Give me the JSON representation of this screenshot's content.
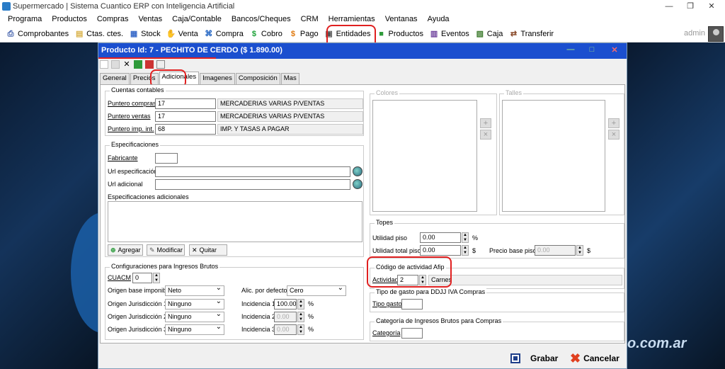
{
  "app": {
    "title": "Supermercado | Sistema Cuantico ERP con Inteligencia Artificial",
    "user": "admin",
    "brand_text": "o.com.ar"
  },
  "window_controls": {
    "minimize": "—",
    "maximize": "❐",
    "close": "✕"
  },
  "menu": [
    "Programa",
    "Productos",
    "Compras",
    "Ventas",
    "Caja/Contable",
    "Bancos/Cheques",
    "CRM",
    "Herramientas",
    "Ventanas",
    "Ayuda"
  ],
  "toolbar": [
    {
      "label": "Comprobantes",
      "icon": "printer-icon",
      "color": "#3a5aa8",
      "glyph": "⎙"
    },
    {
      "label": "Ctas. ctes.",
      "icon": "folder-icon",
      "color": "#d9b24a",
      "glyph": "▤"
    },
    {
      "label": "Stock",
      "icon": "stock-icon",
      "color": "#3a6bc9",
      "glyph": "▦"
    },
    {
      "label": "Venta",
      "icon": "hand-icon",
      "color": "#7a8aa0",
      "glyph": "✋"
    },
    {
      "label": "Compra",
      "icon": "cart-icon",
      "color": "#1a5fc0",
      "glyph": "⌘"
    },
    {
      "label": "Cobro",
      "icon": "dollar-in-icon",
      "color": "#1fa33a",
      "glyph": "$"
    },
    {
      "label": "Pago",
      "icon": "dollar-out-icon",
      "color": "#e07a10",
      "glyph": "$"
    },
    {
      "label": "Entidades",
      "icon": "entities-icon",
      "color": "#555",
      "glyph": "▣"
    },
    {
      "label": "Productos",
      "icon": "box-icon",
      "color": "#2f9a3a",
      "glyph": "■"
    },
    {
      "label": "Eventos",
      "icon": "events-icon",
      "color": "#6a3d9a",
      "glyph": "▥"
    },
    {
      "label": "Caja",
      "icon": "cashbox-icon",
      "color": "#3c7a2c",
      "glyph": "▧"
    },
    {
      "label": "Transferir",
      "icon": "transfer-icon",
      "color": "#8a4a2a",
      "glyph": "⇄"
    }
  ],
  "dialog": {
    "title": "Producto Id: 7 - PECHITO DE CERDO  ($ 1.890.00)",
    "tabs": [
      "General",
      "Precios",
      "Adicionales",
      "Imagenes",
      "Composición",
      "Mas"
    ],
    "active_tab": "Adicionales",
    "cuentas": {
      "title": "Cuentas contables",
      "rows": [
        {
          "label": "Puntero compras",
          "code": "17",
          "desc": "MERCADERIAS VARIAS P/VENTAS"
        },
        {
          "label": "Puntero ventas",
          "code": "17",
          "desc": "MERCADERIAS VARIAS P/VENTAS"
        },
        {
          "label": "Puntero imp. int.",
          "code": "68",
          "desc": "IMP. Y TASAS A PAGAR"
        }
      ]
    },
    "especificaciones": {
      "title": "Especificaciones",
      "fabricante": "Fabricante",
      "url_esp": "Url especificación",
      "url_adic": "Url adicional",
      "adicionales": "Especificaciones adicionales",
      "btn_agregar": "Agregar",
      "btn_modificar": "Modificar",
      "btn_quitar": "Quitar"
    },
    "iibb": {
      "title": "Configuraciones para Ingresos Brutos",
      "cuacm_label": "CUACM",
      "cuacm": "0",
      "origen_label": "Origen base imponible",
      "origen": "Neto",
      "alic_label": "Alic. por defecto",
      "alic": "Cero",
      "rows": [
        {
          "label": "Origen Jurisdicción 1",
          "value": "Ninguno",
          "inc_label": "Incidencia 1",
          "inc": "100.00"
        },
        {
          "label": "Origen Jurisdicción 2",
          "value": "Ninguno",
          "inc_label": "Incidencia 2",
          "inc": "0.00"
        },
        {
          "label": "Origen Jurisdicción 3",
          "value": "Ninguno",
          "inc_label": "Incidencia 3",
          "inc": "0.00"
        }
      ],
      "pct": "%"
    },
    "colores": "Colores",
    "talles": "Talles",
    "topes": {
      "title": "Topes",
      "util_piso_label": "Utilidad piso",
      "util_piso": "0.00",
      "pct": "%",
      "util_total_label": "Utilidad total piso",
      "util_total": "0.00",
      "cur": "$",
      "precio_base_label": "Precio base piso",
      "precio_base": "0.00"
    },
    "afip": {
      "title": "Código de actividad Afip",
      "act_label": "Actividad",
      "act_value": "2",
      "act_desc": "Carnes"
    },
    "ddjj": {
      "title": "Tipo de gasto para DDJJ IVA Compras",
      "label": "Tipo gasto"
    },
    "iibb_compras": {
      "title": "Categoría de Ingresos Brutos para Compras",
      "label": "Categoría"
    },
    "footer": {
      "grabar": "Grabar",
      "cancelar": "Cancelar"
    }
  }
}
